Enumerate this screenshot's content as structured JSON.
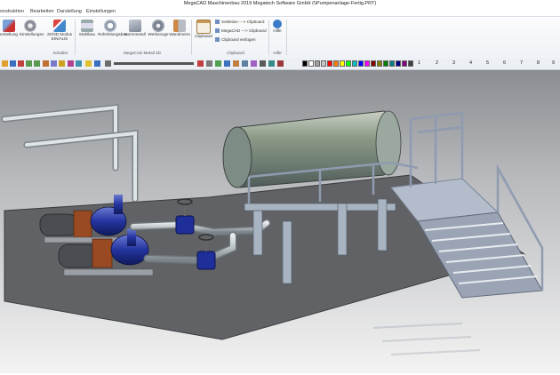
{
  "window": {
    "title": "MegaCAD Maschinenbau 2019 Megatech Software GmbH (\\\\Pumpenanlage-Fertig.PRT)"
  },
  "menu": {
    "tabs": [
      "onstruktion",
      "Bearbeiten",
      "Darstellung",
      "Einstellungen"
    ]
  },
  "ribbon": {
    "buttons": [
      {
        "label": "erstellung",
        "icon": "screwdriver-icon"
      },
      {
        "label": "Einstellungen",
        "icon": "gear-icon"
      },
      {
        "label": "2D/3D Modus",
        "label2": "EIN/AUS",
        "icon": "mode-toggle-icon"
      },
      {
        "label": "Stahlbau",
        "icon": "steel-beam-icon"
      },
      {
        "label": "Rohrleitungsbau",
        "icon": "pipe-icon"
      },
      {
        "label": "Normmetall",
        "icon": "sheet-metal-icon"
      },
      {
        "label": "Werkzeuge",
        "icon": "tools-icon"
      },
      {
        "label": "Wandmenü",
        "icon": "wall-menu-icon"
      },
      {
        "label": "Clipboard",
        "icon": "clipboard-icon"
      },
      {
        "label": "Hilfe",
        "icon": "help-icon"
      }
    ],
    "groups": [
      "Schalter",
      "MegaCAD Metall 3D",
      "Clipboard",
      "Hilfe"
    ],
    "clipboard": [
      "Selektion ---> Clipboard",
      "MegaCAD ---> Clipboard",
      "Clipboard einfügen"
    ]
  },
  "toolbar": {
    "numbers": [
      "1",
      "2",
      "3",
      "4",
      "5",
      "6",
      "7",
      "8",
      "9"
    ],
    "colors": [
      "#000000",
      "#ffffff",
      "#a0a0a0",
      "#c8c8c8",
      "#ff0000",
      "#ff8000",
      "#ffff00",
      "#00ff00",
      "#00c0c0",
      "#0000ff",
      "#ff00ff",
      "#800000",
      "#808000",
      "#008000",
      "#008080",
      "#000080",
      "#800080",
      "#404040"
    ]
  }
}
